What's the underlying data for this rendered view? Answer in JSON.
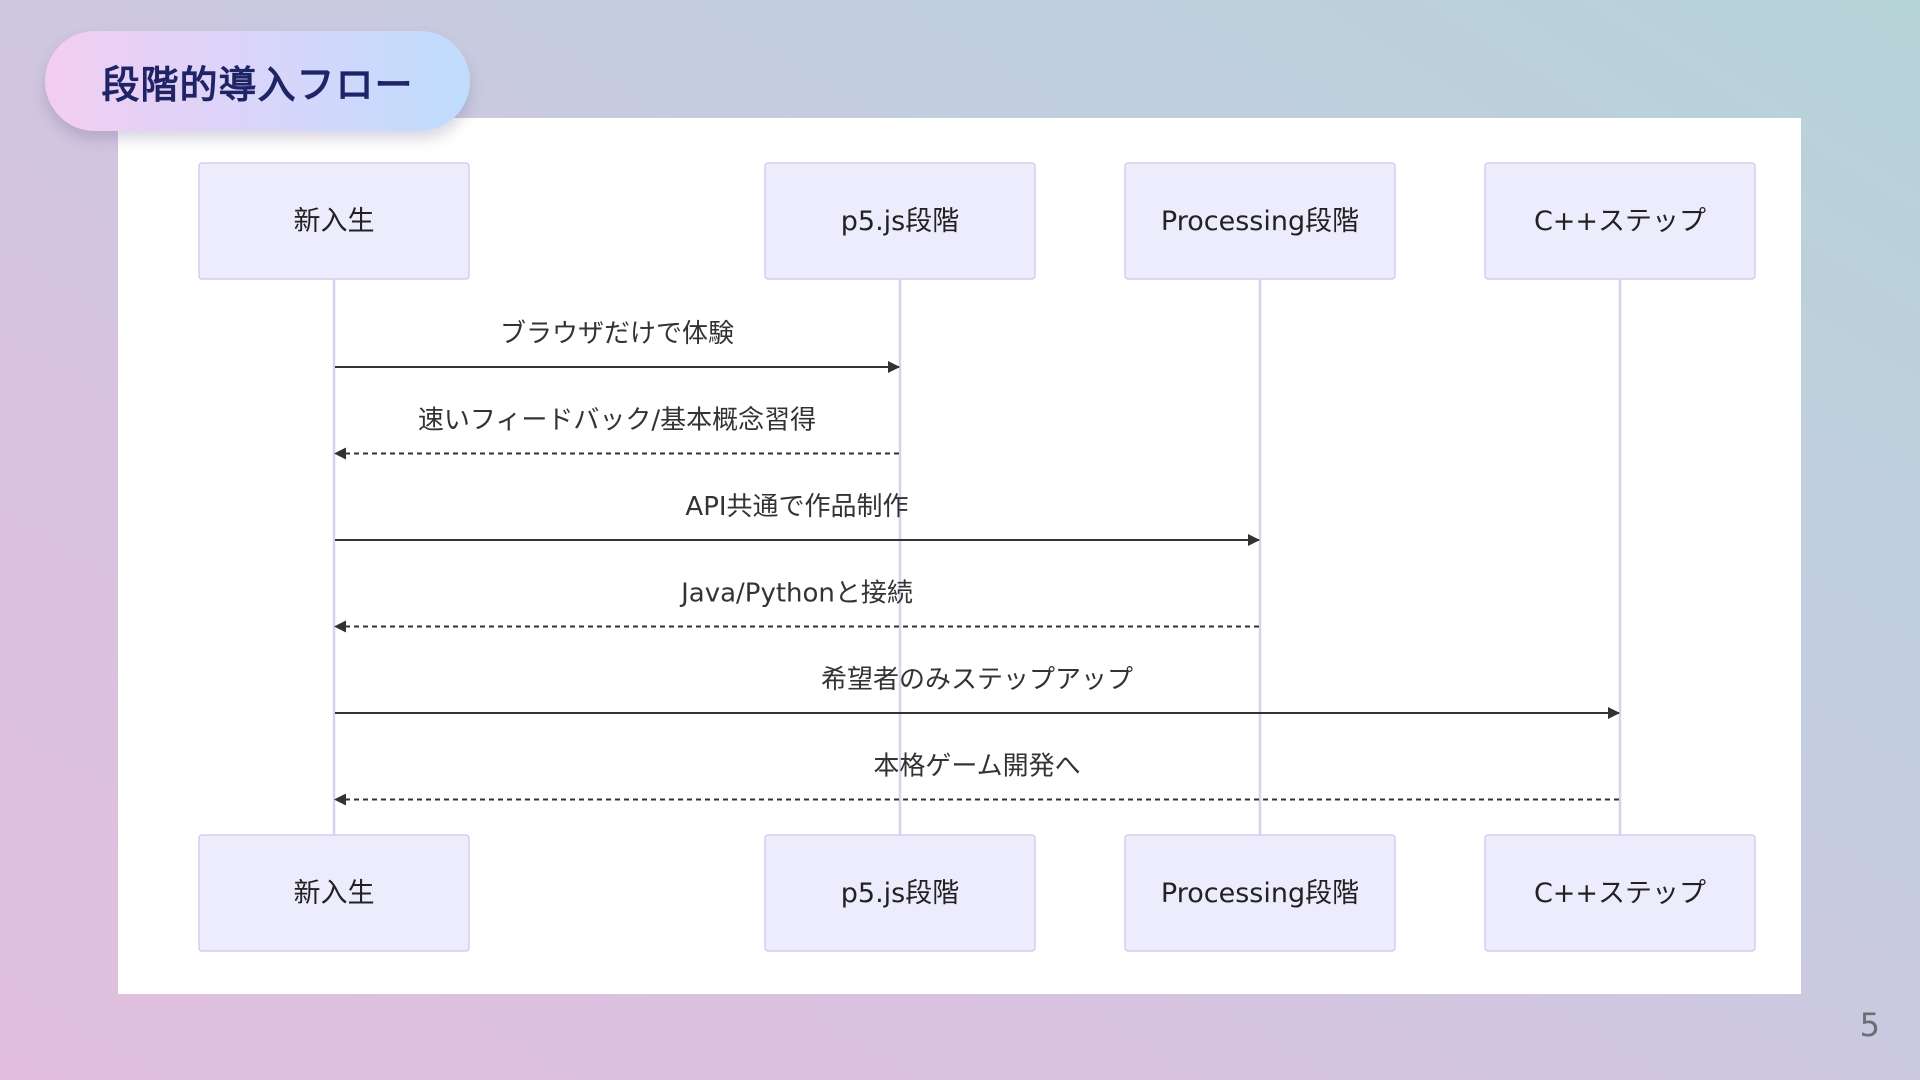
{
  "slide": {
    "title": "段階的導入フロー",
    "page_number": "5"
  },
  "diagram": {
    "type": "sequence",
    "participants": [
      {
        "id": "student",
        "label": "新入生"
      },
      {
        "id": "p5js",
        "label": "p5.js段階"
      },
      {
        "id": "processing",
        "label": "Processing段階"
      },
      {
        "id": "cpp",
        "label": "C++ステップ"
      }
    ],
    "messages": [
      {
        "from": "student",
        "to": "p5js",
        "label": "ブラウザだけで体験",
        "style": "solid"
      },
      {
        "from": "p5js",
        "to": "student",
        "label": "速いフィードバック/基本概念習得",
        "style": "dashed"
      },
      {
        "from": "student",
        "to": "processing",
        "label": "API共通で作品制作",
        "style": "solid"
      },
      {
        "from": "processing",
        "to": "student",
        "label": "Java/Pythonと接続",
        "style": "dashed"
      },
      {
        "from": "student",
        "to": "cpp",
        "label": "希望者のみステップアップ",
        "style": "solid"
      },
      {
        "from": "cpp",
        "to": "student",
        "label": "本格ゲーム開発へ",
        "style": "dashed"
      }
    ],
    "colors": {
      "participant_fill": "#ececfd",
      "participant_stroke": "#d3cdf0",
      "lifeline": "#d8d0f2",
      "arrow": "#333333"
    }
  }
}
